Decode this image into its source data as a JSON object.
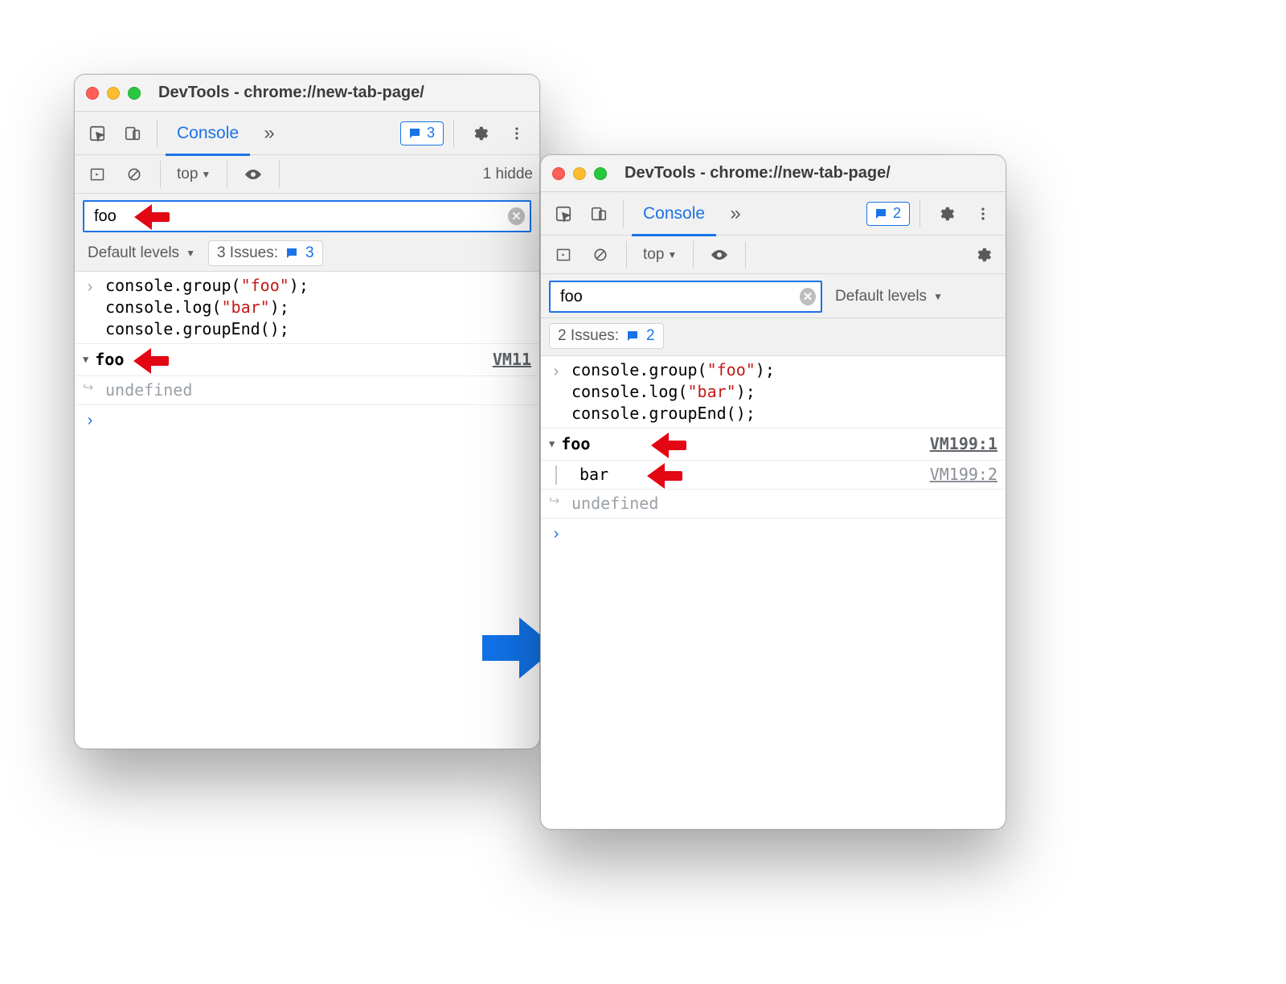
{
  "window_title": "DevTools - chrome://new-tab-page/",
  "tab_active": "Console",
  "context_label": "top",
  "filter_value": "foo",
  "levels_label": "Default levels",
  "left": {
    "badge_count": "3",
    "hidden_text": "1 hidde",
    "issues_prefix": "3 Issues:",
    "issues_count": "3",
    "code_line1_a": "console.group(",
    "code_line1_str": "\"foo\"",
    "code_line1_b": ");",
    "code_line2_a": "console.log(",
    "code_line2_str": "\"bar\"",
    "code_line2_b": ");",
    "code_line3": "console.groupEnd();",
    "group_label": "foo",
    "group_vm": "VM11",
    "undef": "undefined"
  },
  "right": {
    "badge_count": "2",
    "issues_prefix": "2 Issues:",
    "issues_count": "2",
    "code_line1_a": "console.group(",
    "code_line1_str": "\"foo\"",
    "code_line1_b": ");",
    "code_line2_a": "console.log(",
    "code_line2_str": "\"bar\"",
    "code_line2_b": ");",
    "code_line3": "console.groupEnd();",
    "group_label": "foo",
    "group_vm1": "VM199:1",
    "child_label": "bar",
    "child_vm": "VM199:2",
    "undef": "undefined"
  }
}
